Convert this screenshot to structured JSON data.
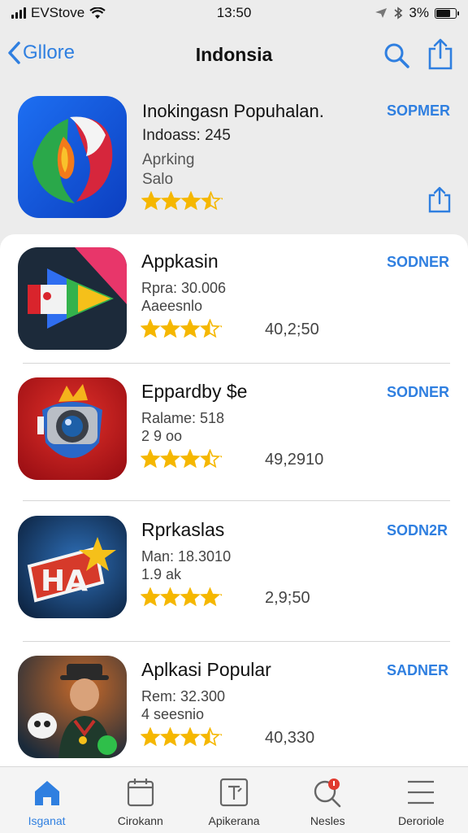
{
  "status_bar": {
    "carrier": "EVStove",
    "time": "13:50",
    "battery": "3%"
  },
  "nav": {
    "back_label": "Gllore",
    "title": "Indonsia"
  },
  "featured": {
    "title": "Inokingasn Popuhalan.",
    "line1": "Indoass: 245",
    "line2": "Aprking",
    "line3": "Salo",
    "rating": 3.5,
    "get_label": "SOPMER"
  },
  "apps": [
    {
      "name": "Appkasin",
      "line1": "Rpra: 30.006",
      "line2": "Aaeesnlo",
      "rating": 3.5,
      "count": "40,2;50",
      "get_label": "SODNER"
    },
    {
      "name": "Eppardby $e",
      "line1": "Ralame: 518",
      "line2": "2 9 oo",
      "rating": 3.5,
      "count": "49,2910",
      "get_label": "SODNER"
    },
    {
      "name": "Rprkaslas",
      "line1": "Man: 18.3010",
      "line2": "1.9 ak",
      "rating": 4,
      "count": "2,9;50",
      "get_label": "SODN2R"
    },
    {
      "name": "Aplkasi Popular",
      "line1": "Rem: 32.300",
      "line2": "4 seesnio",
      "rating": 3.5,
      "count": "40,330",
      "get_label": "SADNER"
    }
  ],
  "tabs": [
    {
      "label": "Isganat",
      "icon": "home-icon",
      "active": true
    },
    {
      "label": "Cirokann",
      "icon": "calendar-icon",
      "active": false
    },
    {
      "label": "Apikerana",
      "icon": "apps-icon",
      "active": false
    },
    {
      "label": "Nesles",
      "icon": "search-icon",
      "active": false
    },
    {
      "label": "Deroriole",
      "icon": "menu-icon",
      "active": false
    }
  ],
  "colors": {
    "accent": "#2f7fe0",
    "star": "#f5b700",
    "card": "#ffffff",
    "background": "#ececec"
  }
}
